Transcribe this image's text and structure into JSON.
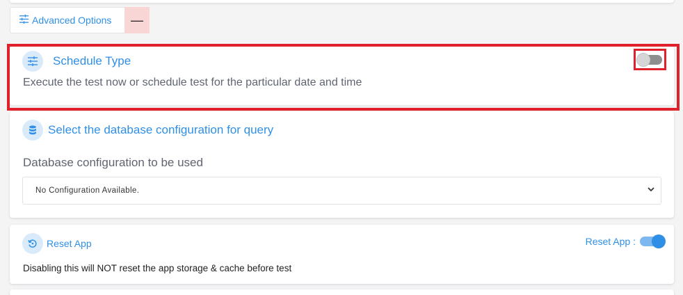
{
  "advanced_options": {
    "label": "Advanced Options",
    "collapse_symbol": "—"
  },
  "schedule": {
    "title": "Schedule Type",
    "description": "Execute the test now or schedule test for the particular date and time",
    "toggle_on": false
  },
  "database": {
    "title": "Select the database configuration for query",
    "field_label": "Database configuration to be used",
    "selected_value": "No Configuration Available."
  },
  "reset_app": {
    "title": "Reset App",
    "toggle_label": "Reset App :",
    "toggle_on": true,
    "description": "Disabling this will NOT reset the app storage & cache before test"
  },
  "icons": {
    "advanced": "sliders-icon",
    "schedule": "sliders-icon",
    "database": "database-icon",
    "reset": "reset-icon",
    "select": "chevron-down-icon"
  },
  "colors": {
    "accent": "#2f8fe6",
    "highlight": "#e0202b",
    "icon_bg": "#d9ebfb",
    "collapse_bg": "#f8d6d6"
  }
}
